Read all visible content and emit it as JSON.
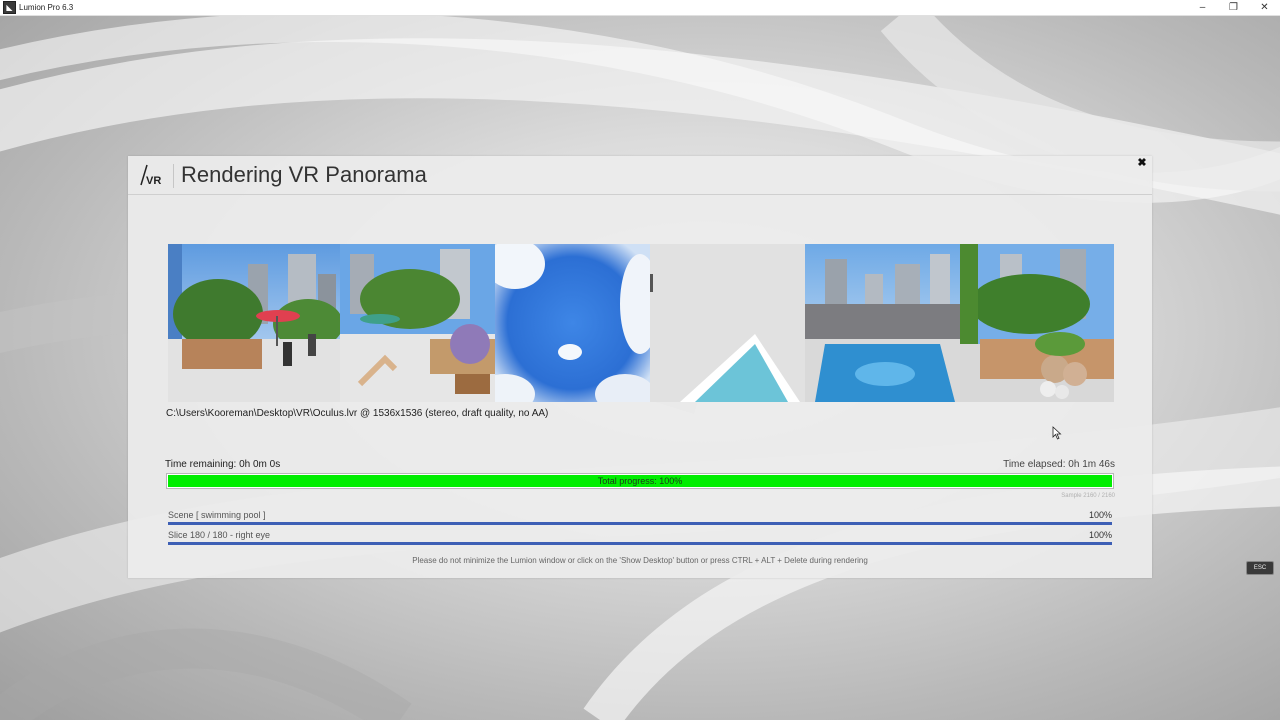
{
  "window": {
    "title": "Lumion Pro 6.3",
    "minimize": "–",
    "restore": "❐",
    "close": "✕"
  },
  "dialog": {
    "logo_text": "VR",
    "title": "Rendering VR Panorama",
    "close_glyph": "✖",
    "output_info": "C:\\Users\\Kooreman\\Desktop\\VR\\Oculus.lvr @ 1536x1536 (stereo, draft quality, no AA)",
    "time_remaining": "Time remaining: 0h 0m 0s",
    "time_elapsed": "Time elapsed: 0h 1m 46s",
    "total_progress_label": "Total progress: 100%",
    "total_progress": 1.0,
    "sample": "Sample 2160 / 2160",
    "scene_label": "Scene [ swimming pool ]",
    "scene_pct": "100%",
    "scene_progress": 1.0,
    "slice_label": "Slice 180 / 180 - right eye",
    "slice_pct": "100%",
    "slice_progress": 1.0,
    "notice": "Please do not minimize the Lumion window or click on the 'Show Desktop' button or press CTRL + ALT + Delete during rendering"
  },
  "preview_tiles": [
    "terrace-with-people",
    "terrace-lounge",
    "sky-up",
    "ground-down",
    "swimming-pool",
    "garden-planters"
  ],
  "esc_key": "ESC",
  "colors": {
    "progress_green": "#00ee00",
    "progress_blue": "#3d5fb5"
  }
}
